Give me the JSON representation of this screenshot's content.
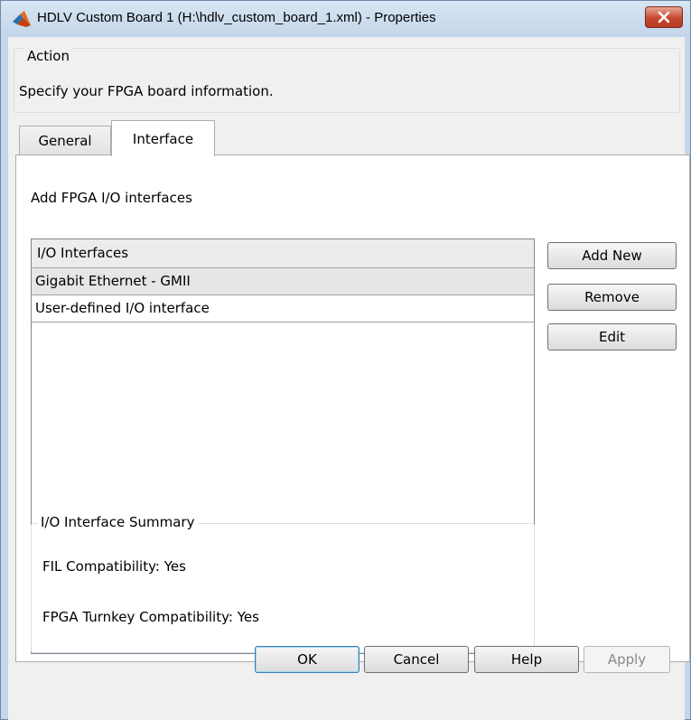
{
  "window": {
    "title": "HDLV Custom Board 1 (H:\\hdlv_custom_board_1.xml) - Properties"
  },
  "action": {
    "legend": "Action",
    "text": "Specify your FPGA board information."
  },
  "tabs": [
    {
      "label": "General"
    },
    {
      "label": "Interface"
    }
  ],
  "interface_panel": {
    "add_label": "Add FPGA I/O interfaces",
    "list_header": "I/O Interfaces",
    "rows": [
      {
        "label": "Gigabit Ethernet - GMII"
      },
      {
        "label": "User-defined I/O interface"
      }
    ],
    "buttons": {
      "add_new": "Add New",
      "remove": "Remove",
      "edit": "Edit"
    },
    "summary": {
      "legend": "I/O Interface Summary",
      "fil": "FIL Compatibility: Yes",
      "turnkey": "FPGA Turnkey Compatibility: Yes"
    }
  },
  "footer": {
    "ok": "OK",
    "cancel": "Cancel",
    "help": "Help",
    "apply": "Apply"
  },
  "icons": {
    "app": "matlab-icon",
    "close": "close-icon"
  },
  "colors": {
    "title_bar": "#c4d6ea",
    "close_button": "#c6492f"
  }
}
